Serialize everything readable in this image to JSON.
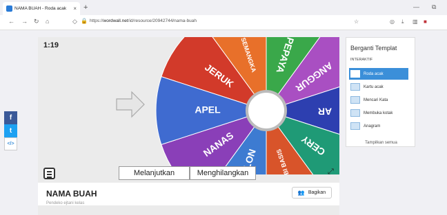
{
  "browser": {
    "tab_title": "NAMA BUAH - Roda acak",
    "tab_close": "×",
    "new_tab": "+",
    "url_prefix": "https://",
    "url_domain": "wordwall.net",
    "url_path": "/id/resource/20942744/nama-buah",
    "minimize": "—",
    "restore": "⧉"
  },
  "activity": {
    "timer": "1:19",
    "title": "NAMA BUAH",
    "author": "Pendeko ejtani kelas",
    "share_label": "Bagikan",
    "continue_label": "Melanjutkan",
    "remove_label": "Menghilangkan"
  },
  "wheel": {
    "segments": [
      {
        "label": "JERUK",
        "color": "#d23a2a"
      },
      {
        "label": "SEMANGKA",
        "color": "#e8702a"
      },
      {
        "label": "PEPAYA",
        "color": "#3aa84a"
      },
      {
        "label": "ANGGUR",
        "color": "#a94fc2"
      },
      {
        "label": "AR",
        "color": "#2d3fb0"
      },
      {
        "label": "CERY",
        "color": "#1f9a76"
      },
      {
        "label": "ARBI BASIS",
        "color": "#d8542a"
      },
      {
        "label": "MELON",
        "color": "#3d7bd1"
      },
      {
        "label": "NANAS",
        "color": "#8a3fb8"
      },
      {
        "label": "APEL",
        "color": "#3f6bd0"
      }
    ]
  },
  "social": {
    "facebook": "f",
    "twitter": "t",
    "embed": "</>"
  },
  "templates": {
    "title": "Berganti Templat",
    "subtitle": "INTERAKTIF",
    "items": [
      {
        "label": "Roda acak"
      },
      {
        "label": "Kartu acak"
      },
      {
        "label": "Mencari Kata"
      },
      {
        "label": "Membuka kotak"
      },
      {
        "label": "Anagram"
      }
    ],
    "show_all": "Tampilkan semua"
  }
}
